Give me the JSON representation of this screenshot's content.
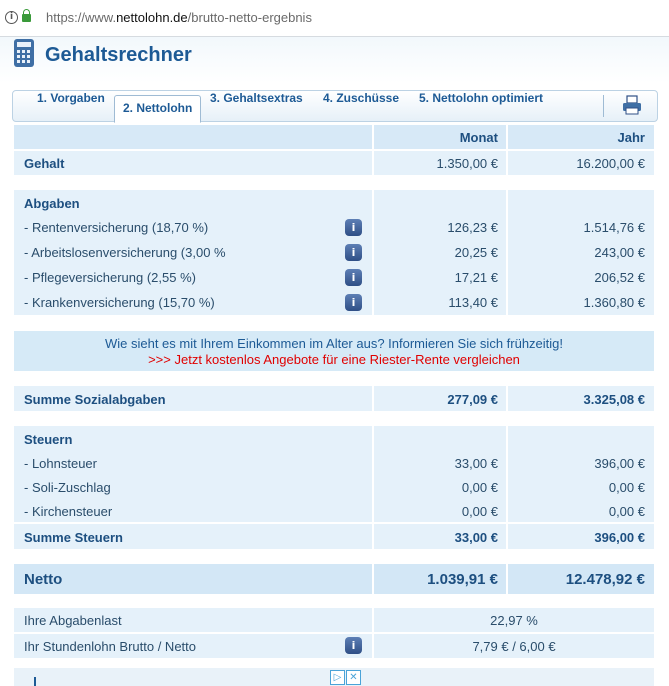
{
  "browser": {
    "url_prefix": "https://www.",
    "url_domain": "nettolohn.de",
    "url_path": "/brutto-netto-ergebnis"
  },
  "header": {
    "title": "Gehaltsrechner"
  },
  "tabs": [
    "1. Vorgaben",
    "2. Nettolohn",
    "3. Gehaltsextras",
    "4. Zuschüsse",
    "5. Nettolohn optimiert"
  ],
  "columns": {
    "monat": "Monat",
    "jahr": "Jahr"
  },
  "gehalt": {
    "label": "Gehalt",
    "monat": "1.350,00 €",
    "jahr": "16.200,00 €"
  },
  "abgaben": {
    "title": "Abgaben",
    "items": [
      {
        "label": "- Rentenversicherung (18,70 %)",
        "monat": "126,23 €",
        "jahr": "1.514,76 €"
      },
      {
        "label": "- Arbeitslosenversicherung (3,00 %",
        "monat": "20,25 €",
        "jahr": "243,00 €"
      },
      {
        "label": "- Pflegeversicherung (2,55 %)",
        "monat": "17,21 €",
        "jahr": "206,52 €"
      },
      {
        "label": "- Krankenversicherung (15,70 %)",
        "monat": "113,40 €",
        "jahr": "1.360,80 €"
      }
    ]
  },
  "promo": {
    "line1": "Wie sieht es mit Ihrem Einkommen im Alter aus? Informieren Sie sich frühzeitig!",
    "line2": ">>> Jetzt kostenlos Angebote für eine Riester-Rente vergleichen"
  },
  "summe_sozial": {
    "label": "Summe Sozialabgaben",
    "monat": "277,09 €",
    "jahr": "3.325,08 €"
  },
  "steuern": {
    "title": "Steuern",
    "items": [
      {
        "label": "- Lohnsteuer",
        "monat": "33,00 €",
        "jahr": "396,00 €"
      },
      {
        "label": "- Soli-Zuschlag",
        "monat": "0,00 €",
        "jahr": "0,00 €"
      },
      {
        "label": "- Kirchensteuer",
        "monat": "0,00 €",
        "jahr": "0,00 €"
      }
    ],
    "summe": {
      "label": "Summe Steuern",
      "monat": "33,00 €",
      "jahr": "396,00 €"
    }
  },
  "netto": {
    "label": "Netto",
    "monat": "1.039,91 €",
    "jahr": "12.478,92 €"
  },
  "abgabenlast": {
    "label": "Ihre Abgabenlast",
    "value": "22,97 %"
  },
  "stundenlohn": {
    "label": "Ihr Stundenlohn Brutto / Netto",
    "value": "7,79 € / 6,00 €"
  },
  "info_glyph": "i",
  "colors": {
    "accent": "#1d5a95",
    "cell": "#e5f1fa",
    "promo_link": "#e00000"
  },
  "icons": [
    "info-icon",
    "lock-icon",
    "calculator-icon",
    "printer-icon",
    "adchoices-icon",
    "close-icon"
  ]
}
